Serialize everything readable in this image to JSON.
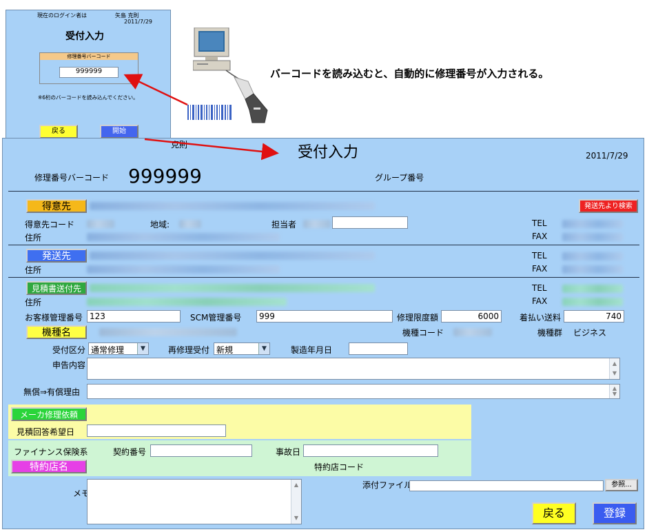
{
  "annotation": "バーコードを読み込むと、自動的に修理番号が入力される。",
  "small_dialog": {
    "login_label": "現在のログイン者は",
    "user_name": "矢島 克則",
    "date": "2011/7/29",
    "title": "受付入力",
    "barcode_header": "修理番号バーコード",
    "barcode_value": "999999",
    "note": "※6桁のバーコードを読み込んでください。",
    "back_label": "戻る",
    "start_label": "開始"
  },
  "main": {
    "partial_text": "克則",
    "title": "受付入力",
    "date": "2011/7/29",
    "barcode_label": "修理番号バーコード",
    "barcode_value": "999999",
    "group_label": "グループ番号",
    "customer_button": "得意先",
    "search_from_ship_button": "発送先より検索",
    "customer_code_label": "得意先コード",
    "region_label": "地域:",
    "person_label": "担当者",
    "tel_label": "TEL",
    "fax_label": "FAX",
    "address_label": "住所",
    "ship_button": "発送先",
    "estimate_button": "見積書送付先",
    "customer_mgmt_label": "お客様管理番号",
    "customer_mgmt_value": "123",
    "scm_label": "SCM管理番号",
    "scm_value": "999",
    "repair_limit_label": "修理限度額",
    "repair_limit_value": "6000",
    "cod_fee_label": "着払い送料",
    "cod_fee_value": "740",
    "model_button": "機種名",
    "model_code_label": "機種コード",
    "model_group_label": "機種群",
    "model_group_value": "ビジネス",
    "reception_type_label": "受付区分",
    "reception_type_value": "通常修理",
    "re_repair_label": "再修理受付",
    "re_repair_value": "新規",
    "mfg_date_label": "製造年月日",
    "complaint_label": "申告内容",
    "free_to_paid_label": "無償⇒有償理由",
    "maker_request_button": "メーカ修理依頼",
    "estimate_reply_label": "見積回答希望日",
    "finance_label": "ファイナンス保険系",
    "contract_label": "契約番号",
    "accident_label": "事故日",
    "dealer_button": "特約店名",
    "dealer_code_label": "特約店コード",
    "memo_label": "メモ",
    "attachment_label": "添付ファイル",
    "browse_label": "参照...",
    "back_label": "戻る",
    "register_label": "登録"
  }
}
